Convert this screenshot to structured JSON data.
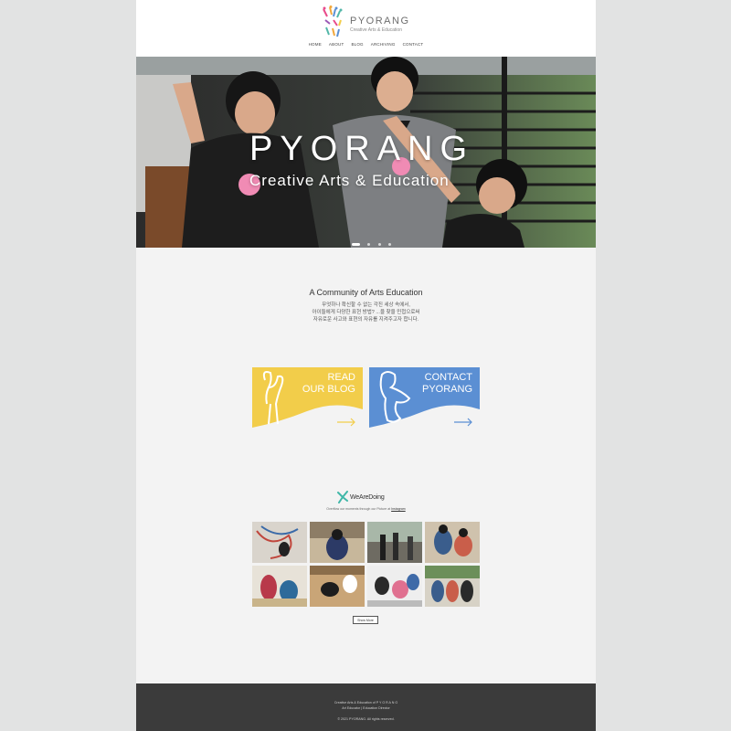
{
  "brand": {
    "name": "PYORANG",
    "tagline": "Creative Arts & Education",
    "colors": {
      "yellow": "#f2cd4a",
      "blue": "#5b8fd3",
      "footer": "#3b3b3b",
      "page": "#f3f3f3"
    }
  },
  "nav": {
    "items": [
      "HOME",
      "ABOUT",
      "BLOG",
      "ARCHIVING",
      "CONTACT"
    ]
  },
  "hero": {
    "title": "PYORANG",
    "subtitle": "Creative Arts & Education",
    "slide_count": 4,
    "active_slide": 1
  },
  "intro": {
    "title": "A Community of Arts Education",
    "lines": [
      "무엇하나 확신할 수 없는 각진 세상 속에서,",
      "아이들에게 다양한 표현 방법? ...을 찾을 민첩으로써",
      "자유로운 사고와 표현의 자유를 지켜주고자 합니다."
    ]
  },
  "cards": [
    {
      "line1": "READ",
      "line2": "OUR BLOG",
      "icon": "arrow-right-icon",
      "color": "#f2cd4a"
    },
    {
      "line1": "CONTACT",
      "line2": "PYORANG",
      "icon": "arrow-right-icon",
      "color": "#5b8fd3"
    }
  ],
  "gallery": {
    "heading": "WeAreDoing",
    "caption": "Overflow our moments through our Picture at",
    "caption_link": "Instagram",
    "more_label": "Show More",
    "tiles": 8
  },
  "footer": {
    "line1": "Creative Arts & Education of P Y O R A N G",
    "line2": "Art Educator  |  Education Director",
    "line3": "© 2021 PYORANG. All rights reserved."
  }
}
